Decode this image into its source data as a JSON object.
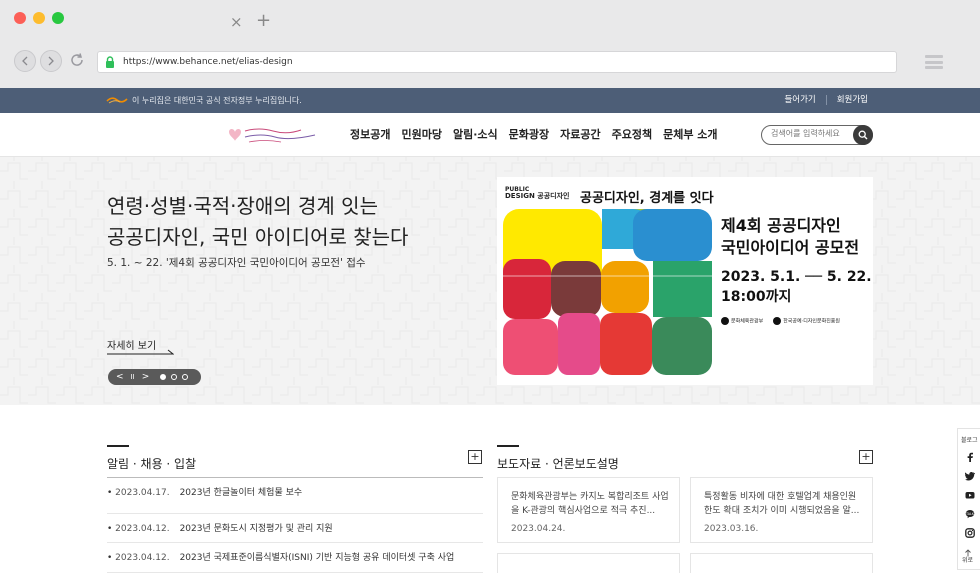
{
  "browser": {
    "tab_close": "×",
    "tab_new": "+",
    "url": "https://www.behance.net/elias-design",
    "icons": [
      "back-icon",
      "forward-icon",
      "reload-icon",
      "lock-icon",
      "menu-icon"
    ]
  },
  "gov_bar": {
    "notice": "이 누리집은 대한민국 공식 전자정부 누리집입니다.",
    "login": "들어가기",
    "join": "회원가입"
  },
  "header": {
    "nav": [
      "정보공개",
      "민원마당",
      "알림·소식",
      "문화광장",
      "자료공간",
      "주요정책",
      "문체부 소개"
    ],
    "search_placeholder": "검색어를 입력하세요"
  },
  "hero": {
    "headline_line1": "연령·성별·국적·장애의 경계 잇는",
    "headline_line2": "공공디자인, 국민 아이디어로 찾는다",
    "subtitle": "5. 1. ~ 22. '제4회 공공디자인 국민아이디어 공모전' 접수",
    "more_label": "자세히 보기",
    "controls": {
      "prev": "<",
      "pause": "II",
      "next": ">"
    },
    "slides_total": 3,
    "slide_active": 1
  },
  "banner": {
    "brand_line1": "PUBLIC",
    "brand_line2": "DESIGN 공공디자인",
    "top": "공공디자인, 경계를 잇다",
    "title_line1": "제4회 공공디자인",
    "title_line2": "국민아이디어 공모전",
    "date_line1": "2023. 5.1. ── 5. 22.",
    "date_line2": "18:00까지",
    "org1": "문화체육관광부",
    "org2": "한국공예·디자인문화진흥원"
  },
  "notices": {
    "title": "알림 · 채용 · 입찰",
    "plus": "+",
    "items": [
      {
        "date": "2023.04.17.",
        "text": "2023년 한글놀이터 체험물 보수"
      },
      {
        "date": "2023.04.12.",
        "text": "2023년 문화도시 지정평가 및 관리 지원"
      },
      {
        "date": "2023.04.12.",
        "text": "2023년 국제표준이름식별자(ISNI) 기반 지능형 공유 데이터셋 구축 사업"
      }
    ]
  },
  "press": {
    "title": "보도자료 · 언론보도설명",
    "plus": "+",
    "cards": [
      {
        "text": "문화체육관광부는 카지노 복합리조트 사업을 K-관광의 핵심사업으로 적극 추진...",
        "date": "2023.04.24."
      },
      {
        "text": "특정활동 비자에 대한 호텔업계 채용인원 한도 확대 조치가 이미 시행되었음을 알...",
        "date": "2023.03.16."
      }
    ]
  },
  "quick": {
    "label": "블로그",
    "top": "위로",
    "icons": [
      "facebook-icon",
      "twitter-icon",
      "youtube-icon",
      "kakao-icon",
      "instagram-icon"
    ]
  },
  "colors": {
    "gov_bar": "#4d5e77",
    "accent_orange": "#f08c00",
    "text_dark": "#222222"
  }
}
